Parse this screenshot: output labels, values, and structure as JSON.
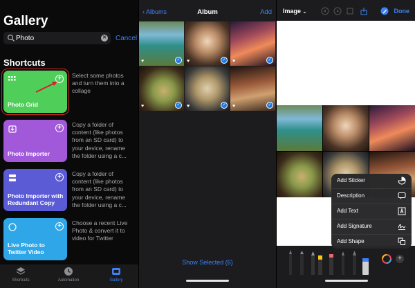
{
  "left": {
    "title": "Gallery",
    "search": {
      "value": "Photo",
      "cancel": "Cancel"
    },
    "section": "Shortcuts",
    "cards": [
      {
        "label": "Photo Grid",
        "color": "#4fcf5a",
        "desc": "Select some photos and turn them into a collage"
      },
      {
        "label": "Photo Importer",
        "color": "#a259d9",
        "desc": "Copy a folder of content (like photos from an SD card) to your device, rename the folder using a c..."
      },
      {
        "label": "Photo Importer with Redundant Copy",
        "color": "#5b5bd6",
        "desc": "Copy a folder of content (like photos from an SD card) to your device, rename the folder using a c..."
      },
      {
        "label": "Live Photo to Twitter Video",
        "color": "#2fa6e8",
        "desc": "Choose a recent Live Photo & convert it to video for Twitter"
      }
    ],
    "tabs": [
      {
        "label": "Shortcuts",
        "icon": "layers-icon"
      },
      {
        "label": "Automation",
        "icon": "clock-icon"
      },
      {
        "label": "Gallery",
        "icon": "gallery-icon"
      }
    ]
  },
  "middle": {
    "back": "Albums",
    "title": "Album",
    "add": "Add",
    "show_selected": "Show Selected (6)",
    "photos": [
      {
        "name": "photo-lake",
        "colors": [
          "#7fb8d6",
          "#2f8f8a",
          "#5c7a3a"
        ]
      },
      {
        "name": "photo-swing",
        "colors": [
          "#e9c9a8",
          "#6b4a35",
          "#2a1e18"
        ]
      },
      {
        "name": "photo-sunset",
        "colors": [
          "#f08a5a",
          "#7a3a4a",
          "#1c1020"
        ]
      },
      {
        "name": "photo-dish",
        "colors": [
          "#3a2a1a",
          "#8a9a4a",
          "#c9b070"
        ]
      },
      {
        "name": "photo-dumplings",
        "colors": [
          "#2a2a2a",
          "#b0986a",
          "#e0d0b0"
        ]
      },
      {
        "name": "photo-skewers",
        "colors": [
          "#3a2a20",
          "#9a5a3a",
          "#d0a070"
        ]
      }
    ]
  },
  "right": {
    "image_menu": "Image",
    "done": "Done",
    "accent": "#3b82f6",
    "add_menu": [
      {
        "label": "Add Sticker",
        "icon": "sticker-icon"
      },
      {
        "label": "Description",
        "icon": "speech-bubble-icon"
      },
      {
        "label": "Add Text",
        "icon": "text-box-icon"
      },
      {
        "label": "Add Signature",
        "icon": "signature-icon"
      },
      {
        "label": "Add Shape",
        "icon": "shapes-icon"
      }
    ],
    "tools": [
      "pen-tool",
      "marker-tool",
      "pencil-tool",
      "highlighter-tool",
      "crayon-tool",
      "fountain-pen-tool",
      "brush-tool",
      "eraser-tool"
    ]
  }
}
